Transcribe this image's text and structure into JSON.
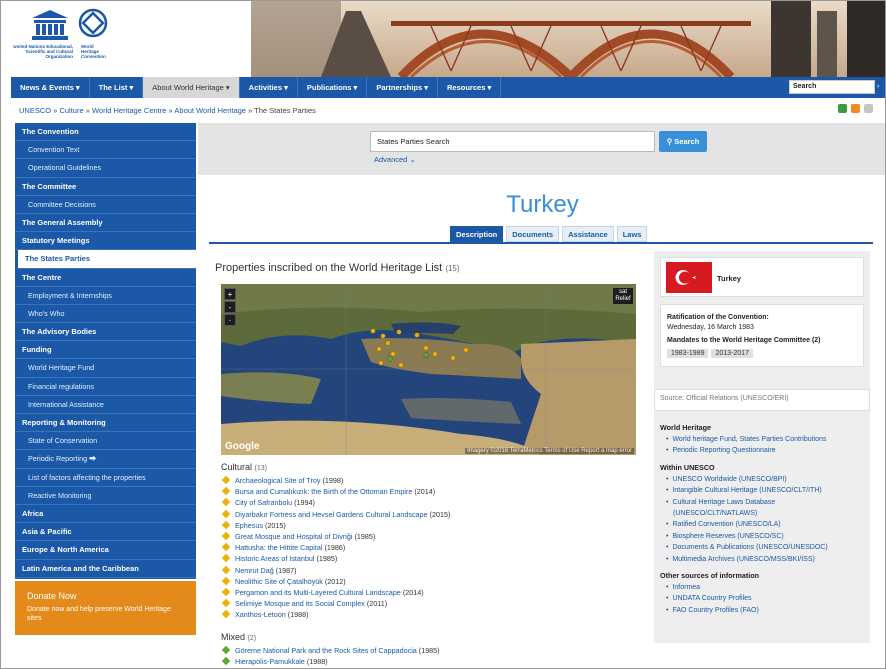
{
  "logo": {
    "unesco_text": "United Nations Educational, Scientific and Cultural Organization",
    "whc_text": "World Heritage Convention"
  },
  "nav": {
    "items": [
      {
        "label": "News & Events ▾",
        "active": false
      },
      {
        "label": "The List ▾",
        "active": false
      },
      {
        "label": "About World Heritage ▾",
        "active": true
      },
      {
        "label": "Activities ▾",
        "active": false
      },
      {
        "label": "Publications ▾",
        "active": false
      },
      {
        "label": "Partnerships ▾",
        "active": false
      },
      {
        "label": "Resources ▾",
        "active": false
      }
    ],
    "search_value": "Search"
  },
  "breadcrumb": {
    "links": [
      "UNESCO",
      "Culture",
      "World Heritage Centre",
      "About World Heritage"
    ],
    "current": "The States Parties"
  },
  "sidebar": [
    {
      "label": "The Convention",
      "type": "head"
    },
    {
      "label": "Convention Text",
      "type": "sub"
    },
    {
      "label": "Operational Guidelines",
      "type": "sub"
    },
    {
      "label": "The Committee",
      "type": "head"
    },
    {
      "label": "Committee Decisions",
      "type": "sub"
    },
    {
      "label": "The General Assembly",
      "type": "head"
    },
    {
      "label": "Statutory Meetings",
      "type": "head"
    },
    {
      "label": "The States Parties",
      "type": "active"
    },
    {
      "label": "The Centre",
      "type": "head"
    },
    {
      "label": "Employment & Internships",
      "type": "sub"
    },
    {
      "label": "Who's Who",
      "type": "sub"
    },
    {
      "label": "The Advisory Bodies",
      "type": "head"
    },
    {
      "label": "Funding",
      "type": "head"
    },
    {
      "label": "World Heritage Fund",
      "type": "sub"
    },
    {
      "label": "Financial regulations",
      "type": "sub"
    },
    {
      "label": "International Assistance",
      "type": "sub"
    },
    {
      "label": "Reporting & Monitoring",
      "type": "head"
    },
    {
      "label": "State of Conservation",
      "type": "sub"
    },
    {
      "label": "Periodic Reporting ⮕",
      "type": "sub"
    },
    {
      "label": "List of factors affecting the properties",
      "type": "sub"
    },
    {
      "label": "Reactive Monitoring",
      "type": "sub"
    },
    {
      "label": "Africa",
      "type": "head"
    },
    {
      "label": "Asia & Pacific",
      "type": "head"
    },
    {
      "label": "Europe & North America",
      "type": "head"
    },
    {
      "label": "Latin America and the Caribbean",
      "type": "head"
    }
  ],
  "donate": {
    "title": "Donate Now",
    "text": "Donate now and help preserve World Heritage sites"
  },
  "states_search": {
    "value": "States Parties Search",
    "button": "Search",
    "advanced": "Advanced ⌄"
  },
  "country": "Turkey",
  "tabs": [
    "Description",
    "Documents",
    "Assistance",
    "Laws"
  ],
  "properties": {
    "title": "Properties inscribed on the World Heritage List",
    "count": "(15)"
  },
  "map": {
    "zoom_in": "+",
    "zoom_out": "-",
    "type_label": "sat Relief",
    "brand": "Google",
    "attribution": "Imagery ©2016 TerraMetrics  Terms of Use  Report a map error"
  },
  "cultural": {
    "heading": "Cultural",
    "count": "(13)",
    "sites": [
      {
        "name": "Archaeological Site of Troy",
        "year": "(1998)"
      },
      {
        "name": "Bursa and Cumalıkızık: the Birth of the Ottoman Empire",
        "year": "(2014)"
      },
      {
        "name": "City of Safranbolu",
        "year": "(1994)"
      },
      {
        "name": "Diyarbakır Fortress and Hevsel Gardens Cultural Landscape",
        "year": "(2015)"
      },
      {
        "name": "Ephesus",
        "year": "(2015)"
      },
      {
        "name": "Great Mosque and Hospital of Divriği",
        "year": "(1985)"
      },
      {
        "name": "Hattusha: the Hittite Capital",
        "year": "(1986)"
      },
      {
        "name": "Historic Areas of Istanbul",
        "year": "(1985)"
      },
      {
        "name": "Nemrut Dağ",
        "year": "(1987)"
      },
      {
        "name": "Neolithic Site of Çatalhöyük",
        "year": "(2012)"
      },
      {
        "name": "Pergamon and its Multi-Layered Cultural Landscape",
        "year": "(2014)"
      },
      {
        "name": "Selimiye Mosque and its Social Complex",
        "year": "(2011)"
      },
      {
        "name": "Xanthos-Letoon",
        "year": "(1988)"
      }
    ]
  },
  "mixed": {
    "heading": "Mixed",
    "count": "(2)",
    "sites": [
      {
        "name": "Göreme National Park and the Rock Sites of Cappadocia",
        "year": "(1985)"
      },
      {
        "name": "Hierapolis-Pamukkale",
        "year": "(1988)"
      }
    ]
  },
  "right": {
    "country_name": "Turkey",
    "ratification_label": "Ratification of the Convention:",
    "ratification_date": "Wednesday, 16 March 1983",
    "mandates_label": "Mandates to the World Heritage Committee (2)",
    "mandates": [
      "1983-1989",
      "2013-2017"
    ],
    "source": "Source: Official Relations (UNESCO/ERI)",
    "groups": [
      {
        "heading": "World Heritage",
        "links": [
          "World heritage Fund, States Parties Contributions",
          "Periodic Reporting Questionnaire"
        ]
      },
      {
        "heading": "Within UNESCO",
        "links": [
          "UNESCO Worldwide (UNESCO/BPI)",
          "Intangible Cultural Heritage (UNESCO/CLT/ITH)",
          "Cultural Heritage Laws Database",
          "(UNESCO/CLT/NATLAWS)",
          "Ratified Convention (UNESCO/LA)",
          "Biosphere Reserves (UNESCO/SC)",
          "Documents & Publications (UNESCO/UNESDOC)",
          "Multimedia Archives (UNESCO/MSS/BKI/ISS)"
        ]
      },
      {
        "heading": "Other sources of information",
        "links": [
          "Informea",
          "UNDATA Country Profiles",
          "FAO Country Profiles (FAO)"
        ]
      }
    ]
  },
  "colors": {
    "brand_blue": "#1b59a8",
    "accent_blue": "#3a8fd9",
    "donate_orange": "#e38a1b",
    "cultural_marker": "#e8b20e",
    "mixed_marker": "#5ea83a",
    "flag_red": "#d71921"
  }
}
